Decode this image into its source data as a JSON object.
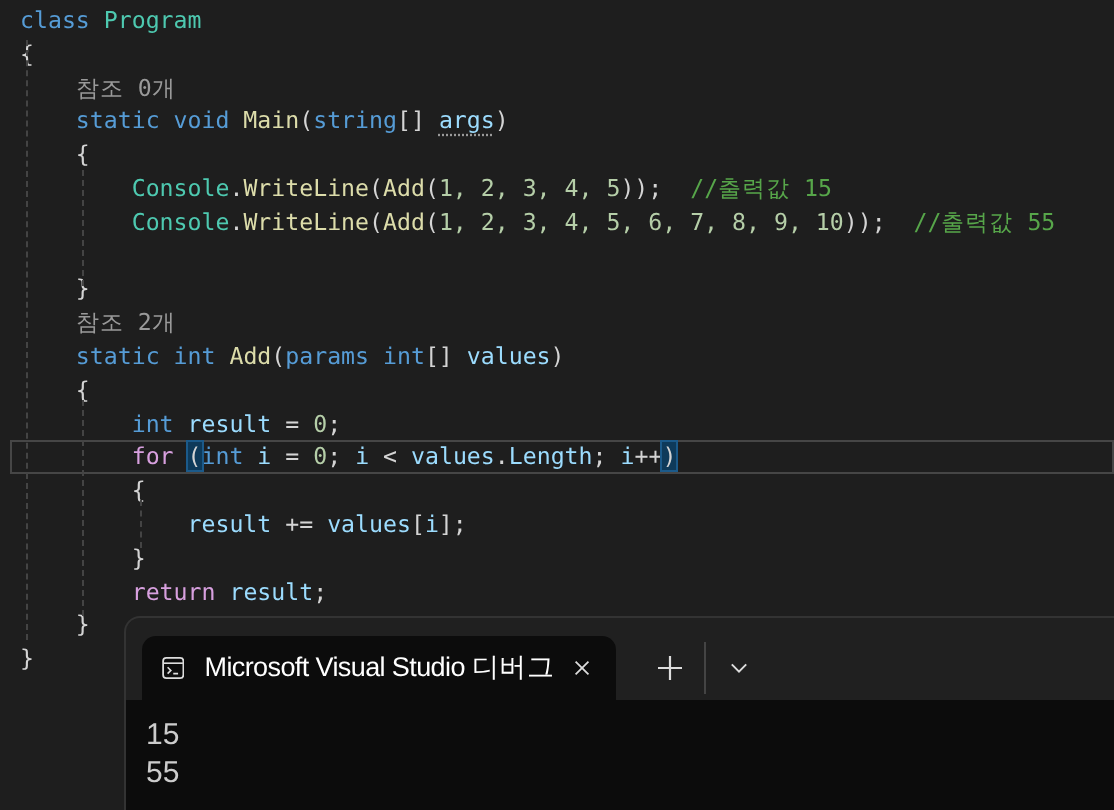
{
  "editor": {
    "lines": [
      {
        "kind": "code",
        "tokens": [
          {
            "text": "class",
            "kind": "kw"
          },
          {
            "text": " Program",
            "kind": "type"
          }
        ]
      },
      {
        "kind": "code",
        "tokens": [
          {
            "text": "{",
            "kind": "plain"
          }
        ]
      },
      {
        "kind": "codelens",
        "text": "    참조 0개"
      },
      {
        "kind": "code",
        "tokens": [
          {
            "text": "    static void",
            "kind": "kw"
          },
          {
            "text": " Main",
            "kind": "method"
          },
          {
            "text": "(",
            "kind": "plain"
          },
          {
            "text": "string",
            "kind": "kw"
          },
          {
            "text": "[] ",
            "kind": "plain"
          },
          {
            "text": "args",
            "kind": "param",
            "suggestion": true
          },
          {
            "text": ")",
            "kind": "plain"
          }
        ]
      },
      {
        "kind": "code",
        "tokens": [
          {
            "text": "    {",
            "kind": "plain"
          }
        ]
      },
      {
        "kind": "code",
        "tokens": [
          {
            "text": "        Console",
            "kind": "type"
          },
          {
            "text": ".",
            "kind": "plain"
          },
          {
            "text": "WriteLine",
            "kind": "method"
          },
          {
            "text": "(",
            "kind": "plain"
          },
          {
            "text": "Add",
            "kind": "method"
          },
          {
            "text": "(",
            "kind": "plain"
          },
          {
            "text": "1, 2, 3, 4, 5",
            "kind": "number"
          },
          {
            "text": "));  ",
            "kind": "plain"
          },
          {
            "text": "//출력값 15",
            "kind": "comment"
          }
        ]
      },
      {
        "kind": "code",
        "tokens": [
          {
            "text": "        Console",
            "kind": "type"
          },
          {
            "text": ".",
            "kind": "plain"
          },
          {
            "text": "WriteLine",
            "kind": "method"
          },
          {
            "text": "(",
            "kind": "plain"
          },
          {
            "text": "Add",
            "kind": "method"
          },
          {
            "text": "(",
            "kind": "plain"
          },
          {
            "text": "1, 2, 3, 4, 5, 6, 7, 8, 9, 10",
            "kind": "number"
          },
          {
            "text": "));  ",
            "kind": "plain"
          },
          {
            "text": "//출력값 55",
            "kind": "comment"
          }
        ]
      },
      {
        "kind": "blank"
      },
      {
        "kind": "code",
        "tokens": [
          {
            "text": "    }",
            "kind": "plain"
          }
        ]
      },
      {
        "kind": "codelens",
        "text": "    참조 2개"
      },
      {
        "kind": "code",
        "tokens": [
          {
            "text": "    static int",
            "kind": "kw"
          },
          {
            "text": " Add",
            "kind": "method"
          },
          {
            "text": "(",
            "kind": "plain"
          },
          {
            "text": "params int",
            "kind": "kw"
          },
          {
            "text": "[] ",
            "kind": "plain"
          },
          {
            "text": "values",
            "kind": "param"
          },
          {
            "text": ")",
            "kind": "plain"
          }
        ]
      },
      {
        "kind": "code",
        "tokens": [
          {
            "text": "    {",
            "kind": "plain"
          }
        ]
      },
      {
        "kind": "code",
        "tokens": [
          {
            "text": "        int",
            "kind": "kw"
          },
          {
            "text": " result",
            "kind": "param"
          },
          {
            "text": " = ",
            "kind": "plain"
          },
          {
            "text": "0",
            "kind": "number"
          },
          {
            "text": ";",
            "kind": "plain"
          }
        ]
      },
      {
        "kind": "code",
        "current": true,
        "tokens": [
          {
            "text": "        for ",
            "kind": "control"
          },
          {
            "text": "(",
            "kind": "bracket"
          },
          {
            "text": "int",
            "kind": "kw"
          },
          {
            "text": " i",
            "kind": "param"
          },
          {
            "text": " = ",
            "kind": "plain"
          },
          {
            "text": "0",
            "kind": "number"
          },
          {
            "text": "; ",
            "kind": "plain"
          },
          {
            "text": "i",
            "kind": "param"
          },
          {
            "text": " < ",
            "kind": "plain"
          },
          {
            "text": "values",
            "kind": "param"
          },
          {
            "text": ".",
            "kind": "plain"
          },
          {
            "text": "Length",
            "kind": "param"
          },
          {
            "text": "; ",
            "kind": "plain"
          },
          {
            "text": "i",
            "kind": "param"
          },
          {
            "text": "++",
            "kind": "plain"
          },
          {
            "text": ")",
            "kind": "bracket"
          }
        ]
      },
      {
        "kind": "code",
        "tokens": [
          {
            "text": "        {",
            "kind": "plain"
          }
        ]
      },
      {
        "kind": "code",
        "tokens": [
          {
            "text": "            result",
            "kind": "param"
          },
          {
            "text": " += ",
            "kind": "plain"
          },
          {
            "text": "values",
            "kind": "param"
          },
          {
            "text": "[",
            "kind": "plain"
          },
          {
            "text": "i",
            "kind": "param"
          },
          {
            "text": "];",
            "kind": "plain"
          }
        ]
      },
      {
        "kind": "code",
        "tokens": [
          {
            "text": "        }",
            "kind": "plain"
          }
        ]
      },
      {
        "kind": "code",
        "tokens": [
          {
            "text": "        return",
            "kind": "control"
          },
          {
            "text": " result",
            "kind": "param"
          },
          {
            "text": ";",
            "kind": "plain"
          }
        ]
      },
      {
        "kind": "code",
        "tokens": [
          {
            "text": "    }",
            "kind": "plain"
          }
        ]
      },
      {
        "kind": "code",
        "tokens": [
          {
            "text": "}",
            "kind": "plain"
          }
        ]
      }
    ]
  },
  "terminal": {
    "tabs": [
      {
        "title": "Microsoft Visual Studio 디버그",
        "selected": true
      }
    ],
    "output": [
      "15",
      "55"
    ]
  }
}
